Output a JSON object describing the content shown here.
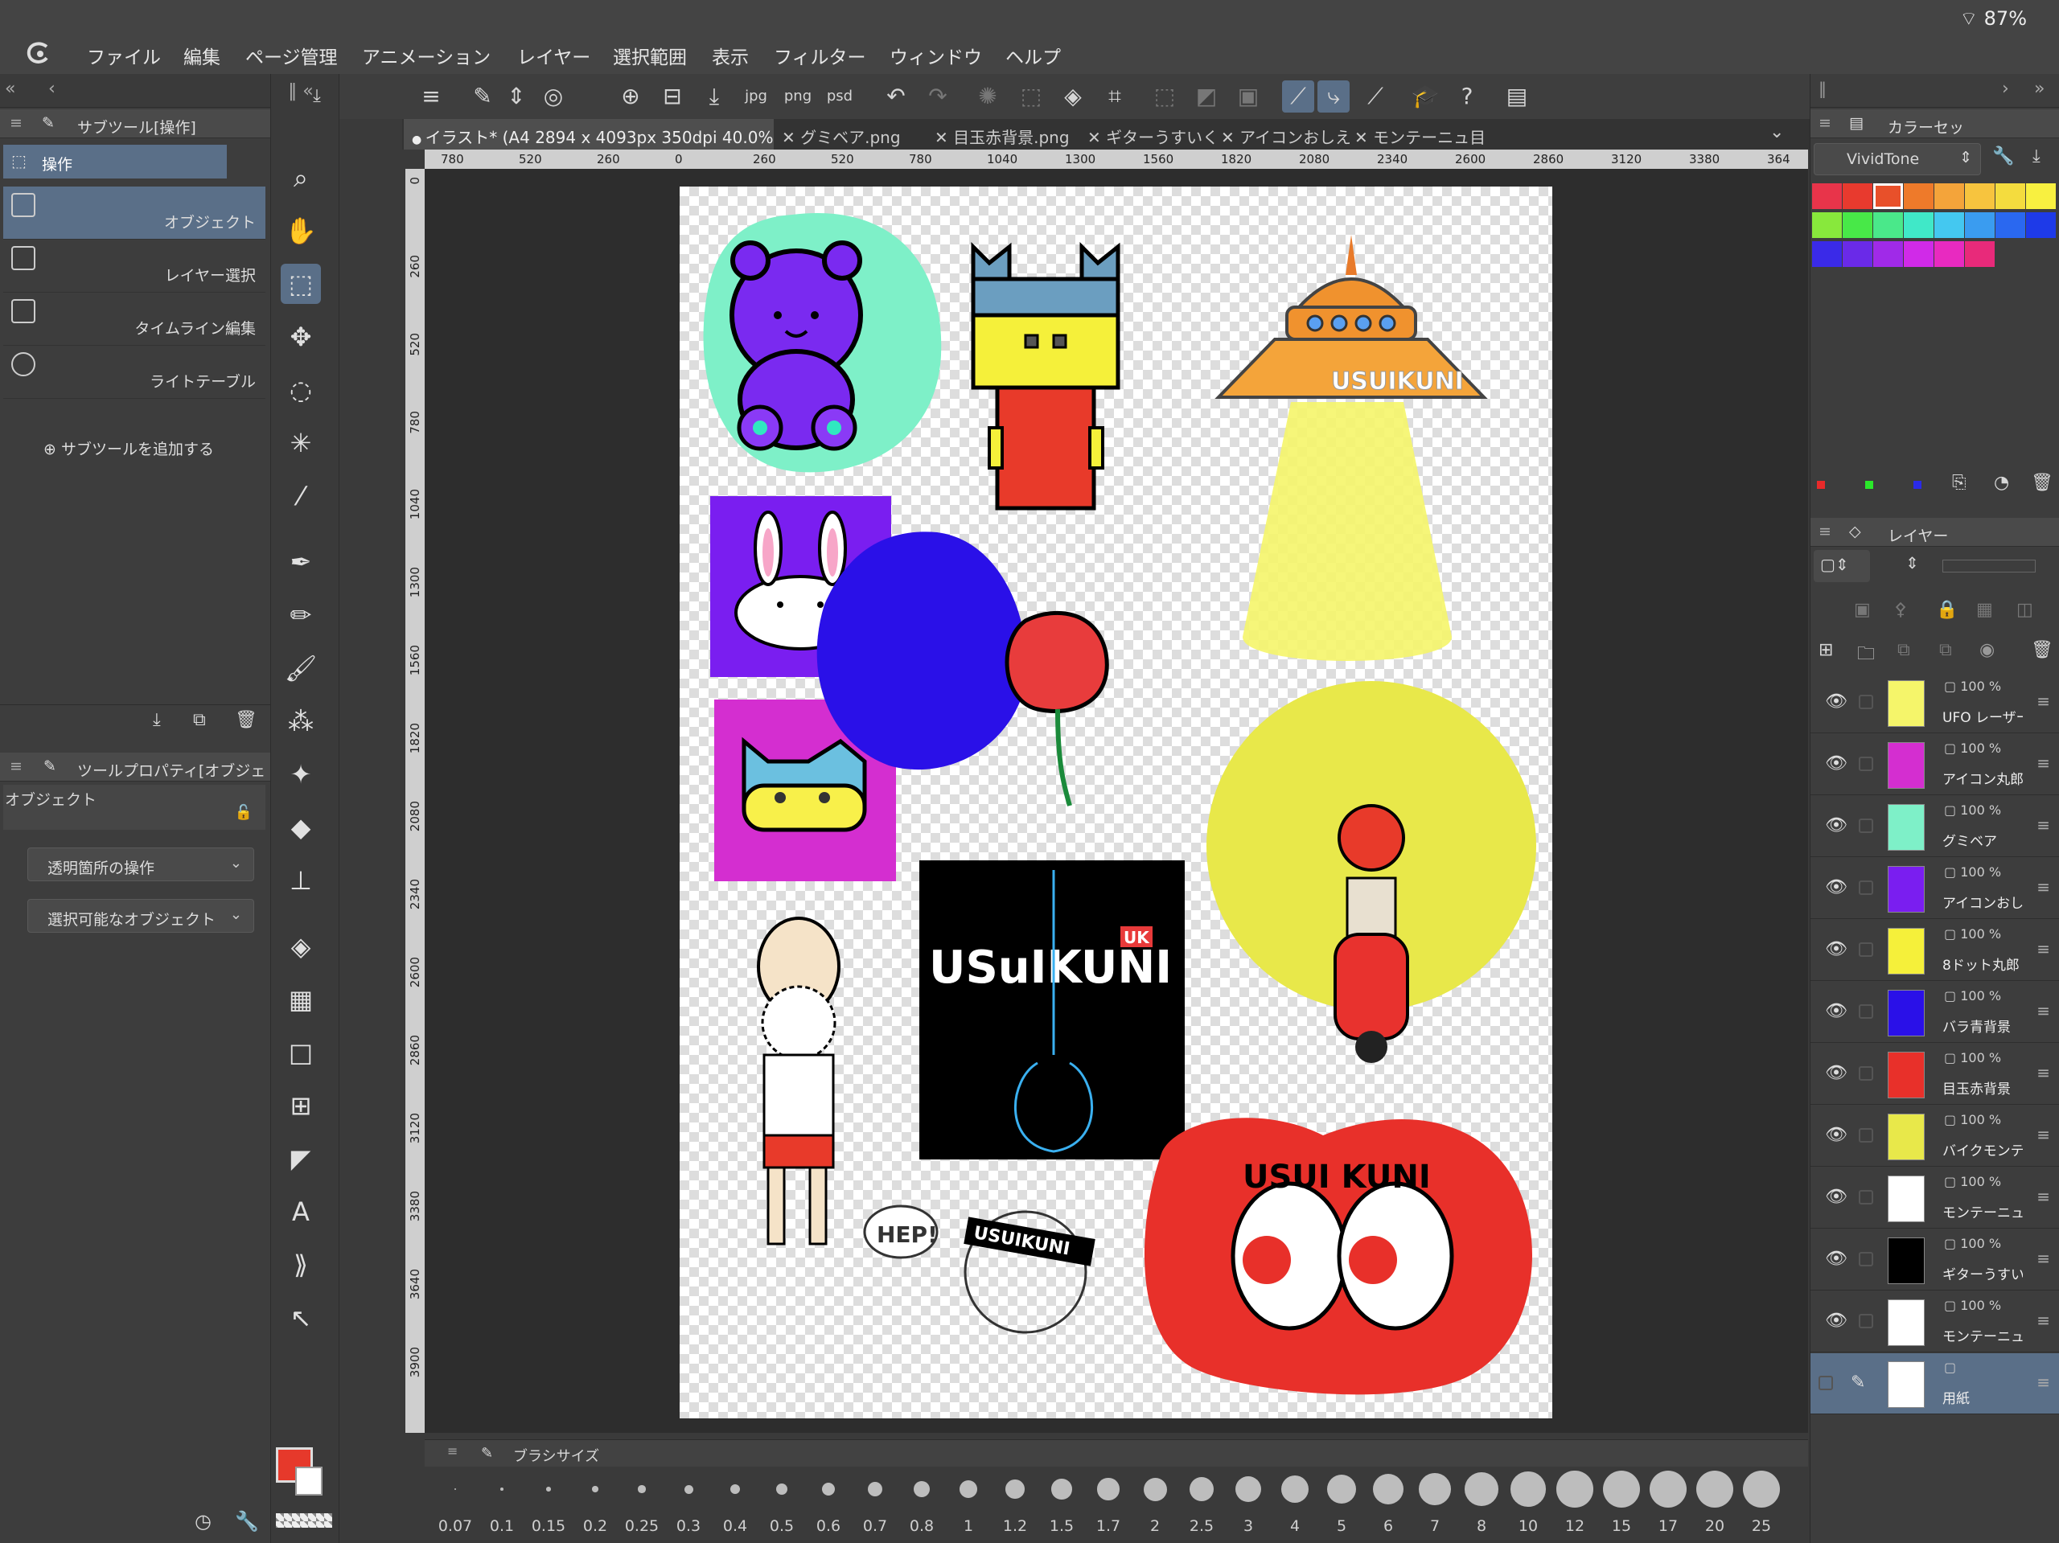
{
  "status": {
    "battery": "87%"
  },
  "menu": [
    "ファイル",
    "編集",
    "ページ管理",
    "アニメーション",
    "レイヤー",
    "選択範囲",
    "表示",
    "フィルター",
    "ウィンドウ",
    "ヘルプ"
  ],
  "subtool_panel": {
    "title": "サブツール[操作]",
    "group": "操作",
    "items": [
      "オブジェクト",
      "レイヤー選択",
      "タイムライン編集",
      "ライトテーブル"
    ],
    "add_label": "サブツールを追加する"
  },
  "tool_property": {
    "title": "ツールプロパティ[オブジェ",
    "section": "オブジェクト",
    "dropdown1": "透明箇所の操作",
    "dropdown2": "選択可能なオブジェクト"
  },
  "tabs": [
    "イラスト* (A4 2894 x 4093px 350dpi 40.0%)",
    "グミベア.png",
    "目玉赤背景.png",
    "ギターうすいく",
    "アイコンおしえ",
    "モンテーニュ目"
  ],
  "ruler_h": [
    "780",
    "520",
    "260",
    "0",
    "260",
    "520",
    "780",
    "1040",
    "1300",
    "1560",
    "1820",
    "2080",
    "2340",
    "2600",
    "2860",
    "3120",
    "3380",
    "364"
  ],
  "ruler_v": [
    "0",
    "260",
    "520",
    "780",
    "1040",
    "1300",
    "1560",
    "1820",
    "2080",
    "2340",
    "2600",
    "2860",
    "3120",
    "3380",
    "3640",
    "3900"
  ],
  "artwork": {
    "ufo_text": "USUIKUNI",
    "guitar_text": "USuIKUNI",
    "guitar_badge": "UK",
    "hep_text": "HEP!",
    "banner_text": "USUIKUNI",
    "eyes_text": "USUI KUNI"
  },
  "brush_panel": {
    "title": "ブラシサイズ",
    "sizes": [
      "0.07",
      "0.1",
      "0.15",
      "0.2",
      "0.25",
      "0.3",
      "0.4",
      "0.5",
      "0.6",
      "0.7",
      "0.8",
      "1",
      "1.2",
      "1.5",
      "1.7",
      "2",
      "2.5",
      "3",
      "4",
      "5",
      "6",
      "7",
      "8",
      "10",
      "12",
      "15",
      "17",
      "20",
      "25"
    ]
  },
  "color_set": {
    "title": "カラーセッ",
    "set_name": "VividTone",
    "swatches": [
      "#e8344a",
      "#e83a2e",
      "#e8502a",
      "#ee7a2a",
      "#f4a43a",
      "#f7c43e",
      "#f4dc3e",
      "#f8f040",
      "#88e83c",
      "#48e848",
      "#4ae88a",
      "#40e8c8",
      "#44c8f0",
      "#3a9cf0",
      "#2a68f0",
      "#1e3ae8",
      "#3a2ae8",
      "#6a2ae8",
      "#a02ae8",
      "#d02ae8",
      "#e82ac0",
      "#e82a7a"
    ]
  },
  "layer_panel": {
    "title": "レイヤー",
    "layers": [
      {
        "opacity": "100 %",
        "name": "UFO レーザー"
      },
      {
        "opacity": "100 %",
        "name": "アイコン丸郎"
      },
      {
        "opacity": "100 %",
        "name": "グミベア"
      },
      {
        "opacity": "100 %",
        "name": "アイコンおし"
      },
      {
        "opacity": "100 %",
        "name": "8ドット丸郎"
      },
      {
        "opacity": "100 %",
        "name": "バラ青背景"
      },
      {
        "opacity": "100 %",
        "name": "目玉赤背景"
      },
      {
        "opacity": "100 %",
        "name": "バイクモンテ"
      },
      {
        "opacity": "100 %",
        "name": "モンテーニュ"
      },
      {
        "opacity": "100 %",
        "name": "ギターうすい"
      },
      {
        "opacity": "100 %",
        "name": "モンテーニュ"
      }
    ],
    "paper_label": "用紙"
  }
}
